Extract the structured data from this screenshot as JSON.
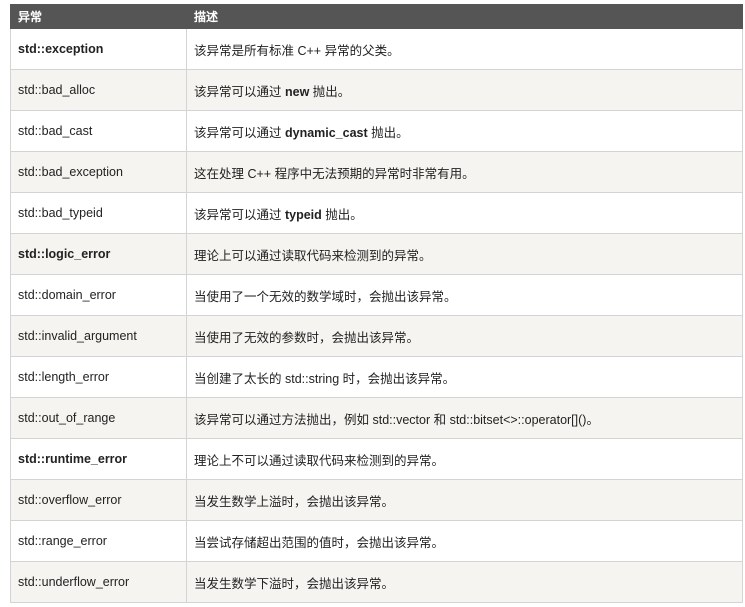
{
  "headers": [
    "异常",
    "描述"
  ],
  "rows": [
    {
      "name": "std::exception",
      "bold": true,
      "desc": [
        "该异常是所有标准 C++ 异常的父类。"
      ]
    },
    {
      "name": "std::bad_alloc",
      "bold": false,
      "desc": [
        "该异常可以通过 ",
        {
          "b": "new"
        },
        " 抛出。"
      ]
    },
    {
      "name": "std::bad_cast",
      "bold": false,
      "desc": [
        "该异常可以通过 ",
        {
          "b": "dynamic_cast"
        },
        " 抛出。"
      ]
    },
    {
      "name": "std::bad_exception",
      "bold": false,
      "desc": [
        "这在处理 C++ 程序中无法预期的异常时非常有用。"
      ]
    },
    {
      "name": "std::bad_typeid",
      "bold": false,
      "desc": [
        "该异常可以通过 ",
        {
          "b": "typeid"
        },
        " 抛出。"
      ]
    },
    {
      "name": "std::logic_error",
      "bold": true,
      "desc": [
        "理论上可以通过读取代码来检测到的异常。"
      ]
    },
    {
      "name": "std::domain_error",
      "bold": false,
      "desc": [
        "当使用了一个无效的数学域时，会抛出该异常。"
      ]
    },
    {
      "name": "std::invalid_argument",
      "bold": false,
      "desc": [
        "当使用了无效的参数时，会抛出该异常。"
      ]
    },
    {
      "name": "std::length_error",
      "bold": false,
      "desc": [
        "当创建了太长的 std::string 时，会抛出该异常。"
      ]
    },
    {
      "name": "std::out_of_range",
      "bold": false,
      "desc": [
        "该异常可以通过方法抛出，例如 std::vector 和 std::bitset<>::operator[]()。"
      ]
    },
    {
      "name": "std::runtime_error",
      "bold": true,
      "desc": [
        "理论上不可以通过读取代码来检测到的异常。"
      ]
    },
    {
      "name": "std::overflow_error",
      "bold": false,
      "desc": [
        "当发生数学上溢时，会抛出该异常。"
      ]
    },
    {
      "name": "std::range_error",
      "bold": false,
      "desc": [
        "当尝试存储超出范围的值时，会抛出该异常。"
      ]
    },
    {
      "name": "std::underflow_error",
      "bold": false,
      "desc": [
        "当发生数学下溢时，会抛出该异常。"
      ]
    }
  ]
}
